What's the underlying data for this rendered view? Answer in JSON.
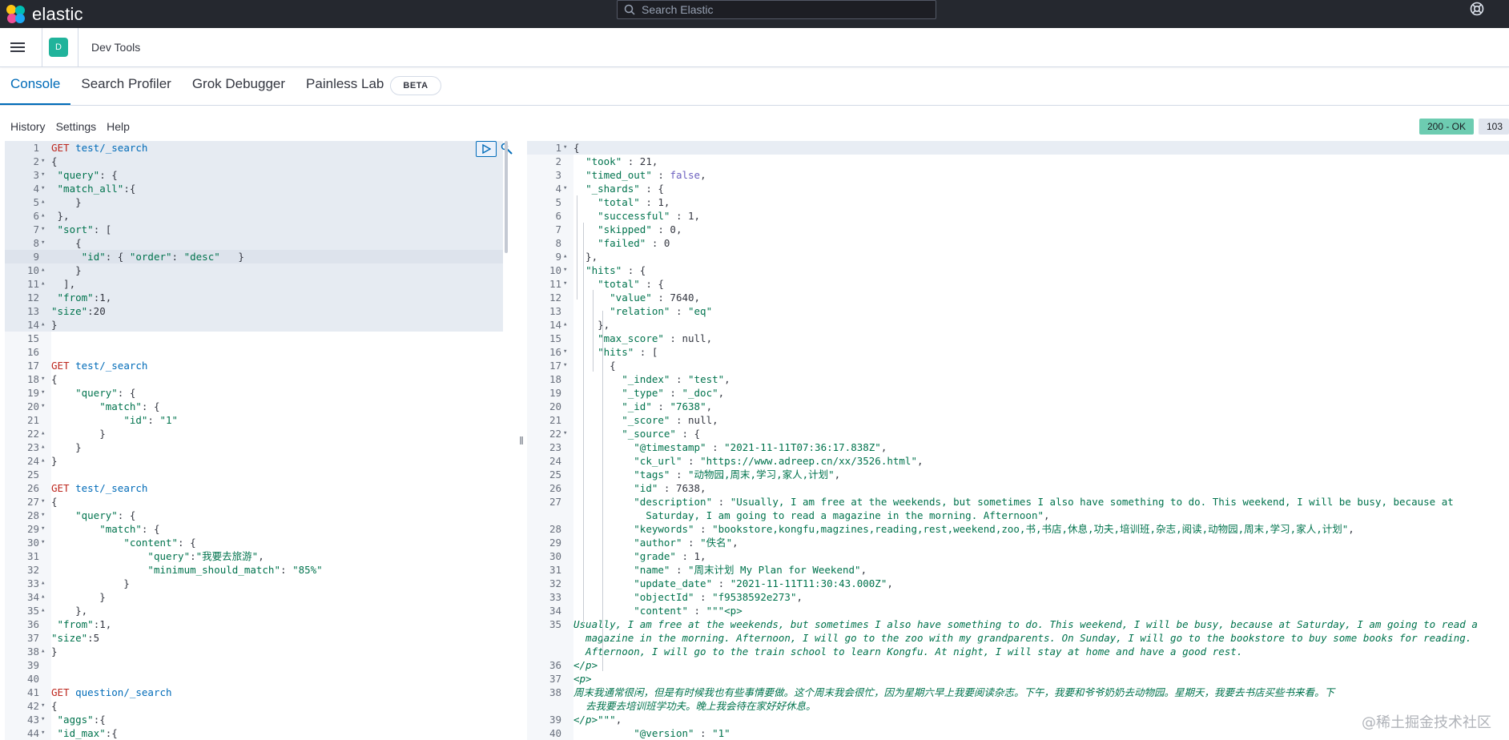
{
  "topbar": {
    "brand": "elastic",
    "search_placeholder": "Search Elastic",
    "logo_colors": [
      "#f04e98",
      "#fec514",
      "#00bfb3",
      "#1ba9f5"
    ]
  },
  "header": {
    "space_letter": "D",
    "breadcrumb": "Dev Tools"
  },
  "tabs": [
    {
      "label": "Console",
      "active": true
    },
    {
      "label": "Search Profiler",
      "active": false
    },
    {
      "label": "Grok Debugger",
      "active": false
    },
    {
      "label": "Painless Lab",
      "active": false
    }
  ],
  "beta_badge": "BETA",
  "toolbar": {
    "history": "History",
    "settings": "Settings",
    "help": "Help"
  },
  "status": "200 - OK",
  "time": "103",
  "watermark": "@稀土掘金技术社区",
  "left_lines": [
    {
      "n": "1",
      "fold": "",
      "html": "<span class='gmethod'>GET</span> <span class='gpath'>test/_search</span>"
    },
    {
      "n": "2",
      "fold": "▾",
      "html": "{"
    },
    {
      "n": "3",
      "fold": "▾",
      "html": " <span class='k'>\"query\"</span>: {"
    },
    {
      "n": "4",
      "fold": "▾",
      "html": " <span class='k'>\"match_all\"</span>:{"
    },
    {
      "n": "5",
      "fold": "▴",
      "html": "    }"
    },
    {
      "n": "6",
      "fold": "▴",
      "html": " },"
    },
    {
      "n": "7",
      "fold": "▾",
      "html": " <span class='k'>\"sort\"</span>: ["
    },
    {
      "n": "8",
      "fold": "▾",
      "html": "    {"
    },
    {
      "n": "9",
      "fold": "",
      "html": "     <span class='k'>\"id\"</span>: { <span class='k'>\"order\"</span>: <span class='s'>\"desc\"</span>   }"
    },
    {
      "n": "10",
      "fold": "▴",
      "html": "    }"
    },
    {
      "n": "11",
      "fold": "▴",
      "html": "  ],"
    },
    {
      "n": "12",
      "fold": "",
      "html": " <span class='k'>\"from\"</span>:1,"
    },
    {
      "n": "13",
      "fold": "",
      "html": "<span class='k'>\"size\"</span>:20"
    },
    {
      "n": "14",
      "fold": "▴",
      "html": "}"
    },
    {
      "n": "15",
      "fold": "",
      "html": ""
    },
    {
      "n": "16",
      "fold": "",
      "html": ""
    },
    {
      "n": "17",
      "fold": "",
      "html": "<span class='gmethod'>GET</span> <span class='gpath'>test/_search</span>"
    },
    {
      "n": "18",
      "fold": "▾",
      "html": "{"
    },
    {
      "n": "19",
      "fold": "▾",
      "html": "    <span class='k'>\"query\"</span>: {"
    },
    {
      "n": "20",
      "fold": "▾",
      "html": "        <span class='k'>\"match\"</span>: {"
    },
    {
      "n": "21",
      "fold": "",
      "html": "            <span class='k'>\"id\"</span>: <span class='s'>\"1\"</span>"
    },
    {
      "n": "22",
      "fold": "▴",
      "html": "        }"
    },
    {
      "n": "23",
      "fold": "▴",
      "html": "    }"
    },
    {
      "n": "24",
      "fold": "▴",
      "html": "}"
    },
    {
      "n": "25",
      "fold": "",
      "html": ""
    },
    {
      "n": "26",
      "fold": "",
      "html": "<span class='gmethod'>GET</span> <span class='gpath'>test/_search</span>"
    },
    {
      "n": "27",
      "fold": "▾",
      "html": "{"
    },
    {
      "n": "28",
      "fold": "▾",
      "html": "    <span class='k'>\"query\"</span>: {"
    },
    {
      "n": "29",
      "fold": "▾",
      "html": "        <span class='k'>\"match\"</span>: {"
    },
    {
      "n": "30",
      "fold": "▾",
      "html": "            <span class='k'>\"content\"</span>: {"
    },
    {
      "n": "31",
      "fold": "",
      "html": "                <span class='k'>\"query\"</span>:<span class='s'>\"我要去旅游\"</span>,"
    },
    {
      "n": "32",
      "fold": "",
      "html": "                <span class='k'>\"minimum_should_match\"</span>: <span class='s'>\"85%\"</span>"
    },
    {
      "n": "33",
      "fold": "▴",
      "html": "            }"
    },
    {
      "n": "34",
      "fold": "▴",
      "html": "        }"
    },
    {
      "n": "35",
      "fold": "▴",
      "html": "    },"
    },
    {
      "n": "36",
      "fold": "",
      "html": " <span class='k'>\"from\"</span>:1,"
    },
    {
      "n": "37",
      "fold": "",
      "html": "<span class='k'>\"size\"</span>:5"
    },
    {
      "n": "38",
      "fold": "▴",
      "html": "}"
    },
    {
      "n": "39",
      "fold": "",
      "html": ""
    },
    {
      "n": "40",
      "fold": "",
      "html": ""
    },
    {
      "n": "41",
      "fold": "",
      "html": "<span class='gmethod'>GET</span> <span class='gpath'>question/_search</span>"
    },
    {
      "n": "42",
      "fold": "▾",
      "html": "{"
    },
    {
      "n": "43",
      "fold": "▾",
      "html": " <span class='k'>\"aggs\"</span>:{"
    },
    {
      "n": "44",
      "fold": "▾",
      "html": " <span class='k'>\"id_max\"</span>:{"
    }
  ],
  "right_lines": [
    {
      "n": "1",
      "fold": "▾",
      "html": "{"
    },
    {
      "n": "2",
      "fold": "",
      "html": "  <span class='k'>\"took\"</span> : 21,"
    },
    {
      "n": "3",
      "fold": "",
      "html": "  <span class='k'>\"timed_out\"</span> : <span class='v'>false</span>,"
    },
    {
      "n": "4",
      "fold": "▾",
      "html": "  <span class='k'>\"_shards\"</span> : {"
    },
    {
      "n": "5",
      "fold": "",
      "html": "    <span class='k'>\"total\"</span> : 1,"
    },
    {
      "n": "6",
      "fold": "",
      "html": "    <span class='k'>\"successful\"</span> : 1,"
    },
    {
      "n": "7",
      "fold": "",
      "html": "    <span class='k'>\"skipped\"</span> : 0,"
    },
    {
      "n": "8",
      "fold": "",
      "html": "    <span class='k'>\"failed\"</span> : 0"
    },
    {
      "n": "9",
      "fold": "▴",
      "html": "  },"
    },
    {
      "n": "10",
      "fold": "▾",
      "html": "  <span class='k'>\"hits\"</span> : {"
    },
    {
      "n": "11",
      "fold": "▾",
      "html": "    <span class='k'>\"total\"</span> : {"
    },
    {
      "n": "12",
      "fold": "",
      "html": "      <span class='k'>\"value\"</span> : 7640,"
    },
    {
      "n": "13",
      "fold": "",
      "html": "      <span class='k'>\"relation\"</span> : <span class='s'>\"eq\"</span>"
    },
    {
      "n": "14",
      "fold": "▴",
      "html": "    },"
    },
    {
      "n": "15",
      "fold": "",
      "html": "    <span class='k'>\"max_score\"</span> : null,"
    },
    {
      "n": "16",
      "fold": "▾",
      "html": "    <span class='k'>\"hits\"</span> : ["
    },
    {
      "n": "17",
      "fold": "▾",
      "html": "      {"
    },
    {
      "n": "18",
      "fold": "",
      "html": "        <span class='k'>\"_index\"</span> : <span class='s'>\"test\"</span>,"
    },
    {
      "n": "19",
      "fold": "",
      "html": "        <span class='k'>\"_type\"</span> : <span class='s'>\"_doc\"</span>,"
    },
    {
      "n": "20",
      "fold": "",
      "html": "        <span class='k'>\"_id\"</span> : <span class='s'>\"7638\"</span>,"
    },
    {
      "n": "21",
      "fold": "",
      "html": "        <span class='k'>\"_score\"</span> : null,"
    },
    {
      "n": "22",
      "fold": "▾",
      "html": "        <span class='k'>\"_source\"</span> : {"
    },
    {
      "n": "23",
      "fold": "",
      "html": "          <span class='k'>\"@timestamp\"</span> : <span class='s'>\"2021-11-11T07:36:17.838Z\"</span>,"
    },
    {
      "n": "24",
      "fold": "",
      "html": "          <span class='k'>\"ck_url\"</span> : <span class='s'>\"https://www.adreep.cn/xx/3526.html\"</span>,"
    },
    {
      "n": "25",
      "fold": "",
      "html": "          <span class='k'>\"tags\"</span> : <span class='s'>\"动物园,周末,学习,家人,计划\"</span>,"
    },
    {
      "n": "26",
      "fold": "",
      "html": "          <span class='k'>\"id\"</span> : 7638,"
    },
    {
      "n": "27",
      "fold": "",
      "html": "          <span class='k'>\"description\"</span> : <span class='s'>\"Usually, I am free at the weekends, but sometimes I also have something to do. This weekend, I will be busy, because at</span>"
    },
    {
      "n": "",
      "fold": "",
      "html": "<span class='s'>            Saturday, I am going to read a magazine in the morning. Afternoon\"</span>,"
    },
    {
      "n": "28",
      "fold": "",
      "html": "          <span class='k'>\"keywords\"</span> : <span class='s'>\"bookstore,kongfu,magzines,reading,rest,weekend,zoo,书,书店,休息,功夫,培训班,杂志,阅读,动物园,周末,学习,家人,计划\"</span>,"
    },
    {
      "n": "29",
      "fold": "",
      "html": "          <span class='k'>\"author\"</span> : <span class='s'>\"佚名\"</span>,"
    },
    {
      "n": "30",
      "fold": "",
      "html": "          <span class='k'>\"grade\"</span> : 1,"
    },
    {
      "n": "31",
      "fold": "",
      "html": "          <span class='k'>\"name\"</span> : <span class='s'>\"周末计划 My Plan for Weekend\"</span>,"
    },
    {
      "n": "32",
      "fold": "",
      "html": "          <span class='k'>\"update_date\"</span> : <span class='s'>\"2021-11-11T11:30:43.000Z\"</span>,"
    },
    {
      "n": "33",
      "fold": "",
      "html": "          <span class='k'>\"objectId\"</span> : <span class='s'>\"f9538592e273\"</span>,"
    },
    {
      "n": "34",
      "fold": "",
      "html": "          <span class='k'>\"content\"</span> : <span class='s'>\"\"\"&lt;p&gt;</span>"
    },
    {
      "n": "35",
      "fold": "",
      "html": "<span class='it'>Usually, I am free at the weekends, but sometimes I also have something to do. This weekend, I will be busy, because at Saturday, I am going to read a</span>"
    },
    {
      "n": "",
      "fold": "",
      "html": "<span class='it'>  magazine in the morning. Afternoon, I will go to the zoo with my grandparents. On Sunday, I will go to the bookstore to buy some books for reading.</span>"
    },
    {
      "n": "",
      "fold": "",
      "html": "<span class='it'>  Afternoon, I will go to the train school to learn Kongfu. At night, I will stay at home and have a good rest.</span>"
    },
    {
      "n": "36",
      "fold": "",
      "html": "<span class='it'>&lt;/p&gt;</span>"
    },
    {
      "n": "37",
      "fold": "",
      "html": "<span class='it'>&lt;p&gt;</span>"
    },
    {
      "n": "38",
      "fold": "",
      "html": "<span class='it'>周末我通常很闲，但是有时候我也有些事情要做。这个周末我会很忙，因为星期六早上我要阅读杂志。下午，我要和爷爷奶奶去动物园。星期天，我要去书店买些书来看。下</span>"
    },
    {
      "n": "",
      "fold": "",
      "html": "<span class='it'>  去我要去培训班学功夫。晚上我会待在家好好休息。</span>"
    },
    {
      "n": "39",
      "fold": "",
      "html": "<span class='it'>&lt;/p&gt;\"\"\"</span>,"
    },
    {
      "n": "40",
      "fold": "",
      "html": "          <span class='k'>\"@version\"</span> : <span class='s'>\"1\"</span>"
    }
  ]
}
